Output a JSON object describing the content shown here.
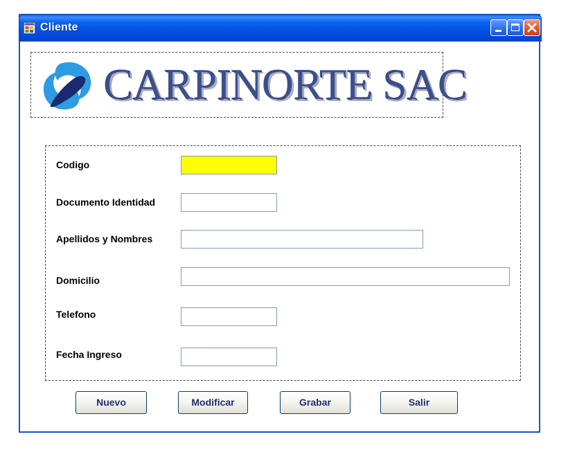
{
  "window": {
    "title": "Cliente",
    "icon": "form-app-icon",
    "controls": {
      "minimize_icon": "minimize-icon",
      "maximize_icon": "maximize-icon",
      "close_icon": "close-icon"
    }
  },
  "logo": {
    "text": "CARPINORTE SAC",
    "icon": "swirl-logo-icon"
  },
  "form": {
    "fields": [
      {
        "label": "Codigo",
        "value": "",
        "highlight": "#ffff00"
      },
      {
        "label": "Documento Identidad",
        "value": ""
      },
      {
        "label": "Apellidos y Nombres",
        "value": ""
      },
      {
        "label": "Domicilio",
        "value": ""
      },
      {
        "label": "Telefono",
        "value": ""
      },
      {
        "label": "Fecha Ingreso",
        "value": ""
      }
    ]
  },
  "buttons": {
    "nuevo": "Nuevo",
    "modificar": "Modificar",
    "grabar": "Grabar",
    "salir": "Salir"
  },
  "colors": {
    "titlebar": "#0553e3",
    "button_text": "#1f2f6b",
    "highlight_field": "#ffff00",
    "close_button": "#e2572e"
  }
}
